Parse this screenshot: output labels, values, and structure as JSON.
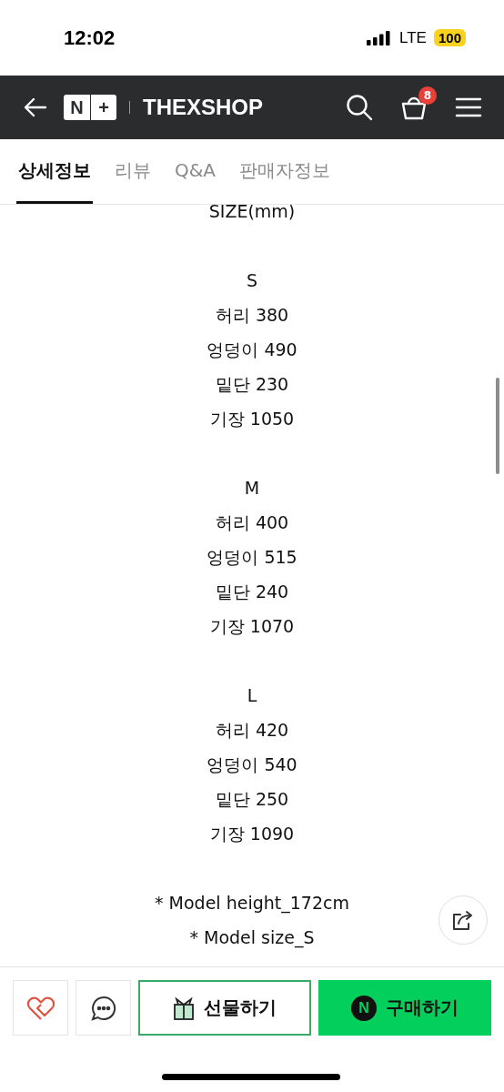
{
  "status_bar": {
    "time": "12:02",
    "network": "LTE",
    "battery": "100"
  },
  "header": {
    "logo": [
      "N",
      "+"
    ],
    "brand": "THEXSHOP",
    "cart_count": "8"
  },
  "tabs": [
    {
      "label": "상세정보",
      "selected": true
    },
    {
      "label": "리뷰",
      "selected": false
    },
    {
      "label": "Q&A",
      "selected": false
    },
    {
      "label": "판매자정보",
      "selected": false
    }
  ],
  "content": {
    "title": "SIZE(mm)",
    "sizes": [
      {
        "label": "S",
        "measurements": [
          "허리 380",
          "엉덩이 490",
          "밑단 230",
          "기장 1050"
        ]
      },
      {
        "label": "M",
        "measurements": [
          "허리 400",
          "엉덩이 515",
          "밑단 240",
          "기장 1070"
        ]
      },
      {
        "label": "L",
        "measurements": [
          "허리 420",
          "엉덩이 540",
          "밑단 250",
          "기장 1090"
        ]
      }
    ],
    "notes": [
      "* Model height_172cm",
      "* Model size_S"
    ]
  },
  "bottom_bar": {
    "gift": "선물하기",
    "buy_mark": "N",
    "buy": "구매하기"
  }
}
